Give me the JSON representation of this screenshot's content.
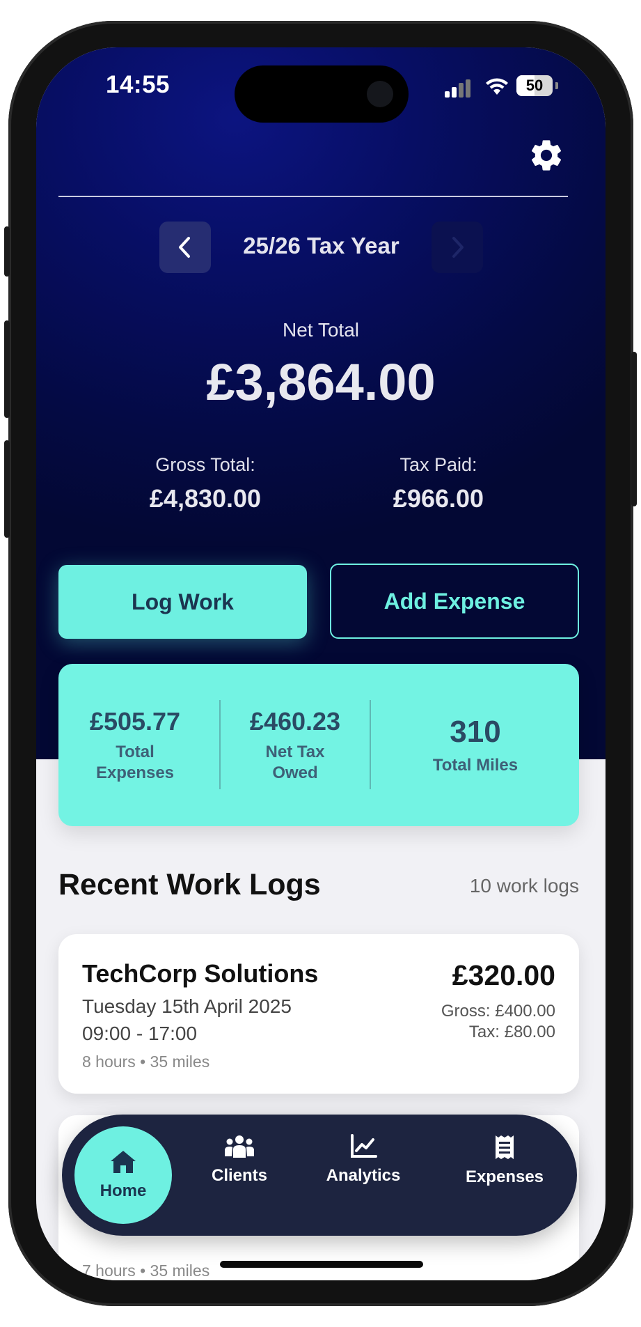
{
  "status_bar": {
    "time": "14:55",
    "battery": "50"
  },
  "header": {
    "tax_year": "25/26 Tax Year"
  },
  "totals": {
    "net_label": "Net Total",
    "net_value": "£3,864.00",
    "gross_label": "Gross Total:",
    "gross_value": "£4,830.00",
    "tax_label": "Tax Paid:",
    "tax_value": "£966.00"
  },
  "actions": {
    "log_work": "Log Work",
    "add_expense": "Add Expense"
  },
  "summary": {
    "expenses_value": "£505.77",
    "expenses_line1": "Total",
    "expenses_line2": "Expenses",
    "tax_owed_value": "£460.23",
    "tax_owed_line1": "Net Tax",
    "tax_owed_line2": "Owed",
    "miles_value": "310",
    "miles_label": "Total Miles"
  },
  "recent": {
    "title": "Recent Work Logs",
    "count": "10 work logs",
    "logs": [
      {
        "client": "TechCorp Solutions",
        "date": "Tuesday 15th April 2025",
        "time": "09:00 - 17:00",
        "meta": "8 hours • 35 miles",
        "net": "£320.00",
        "gross": "Gross: £400.00",
        "tax": "Tax: £80.00"
      },
      {
        "meta": "7 hours • 35 miles"
      }
    ]
  },
  "tabs": [
    {
      "label": "Home",
      "icon": "home-icon",
      "active": true
    },
    {
      "label": "Clients",
      "icon": "clients-icon"
    },
    {
      "label": "Analytics",
      "icon": "analytics-icon"
    },
    {
      "label": "Expenses",
      "icon": "receipt-icon"
    }
  ],
  "colors": {
    "accent": "#6ef0e1",
    "hero_dark": "#040a44",
    "tab_bar": "#1d2440"
  }
}
